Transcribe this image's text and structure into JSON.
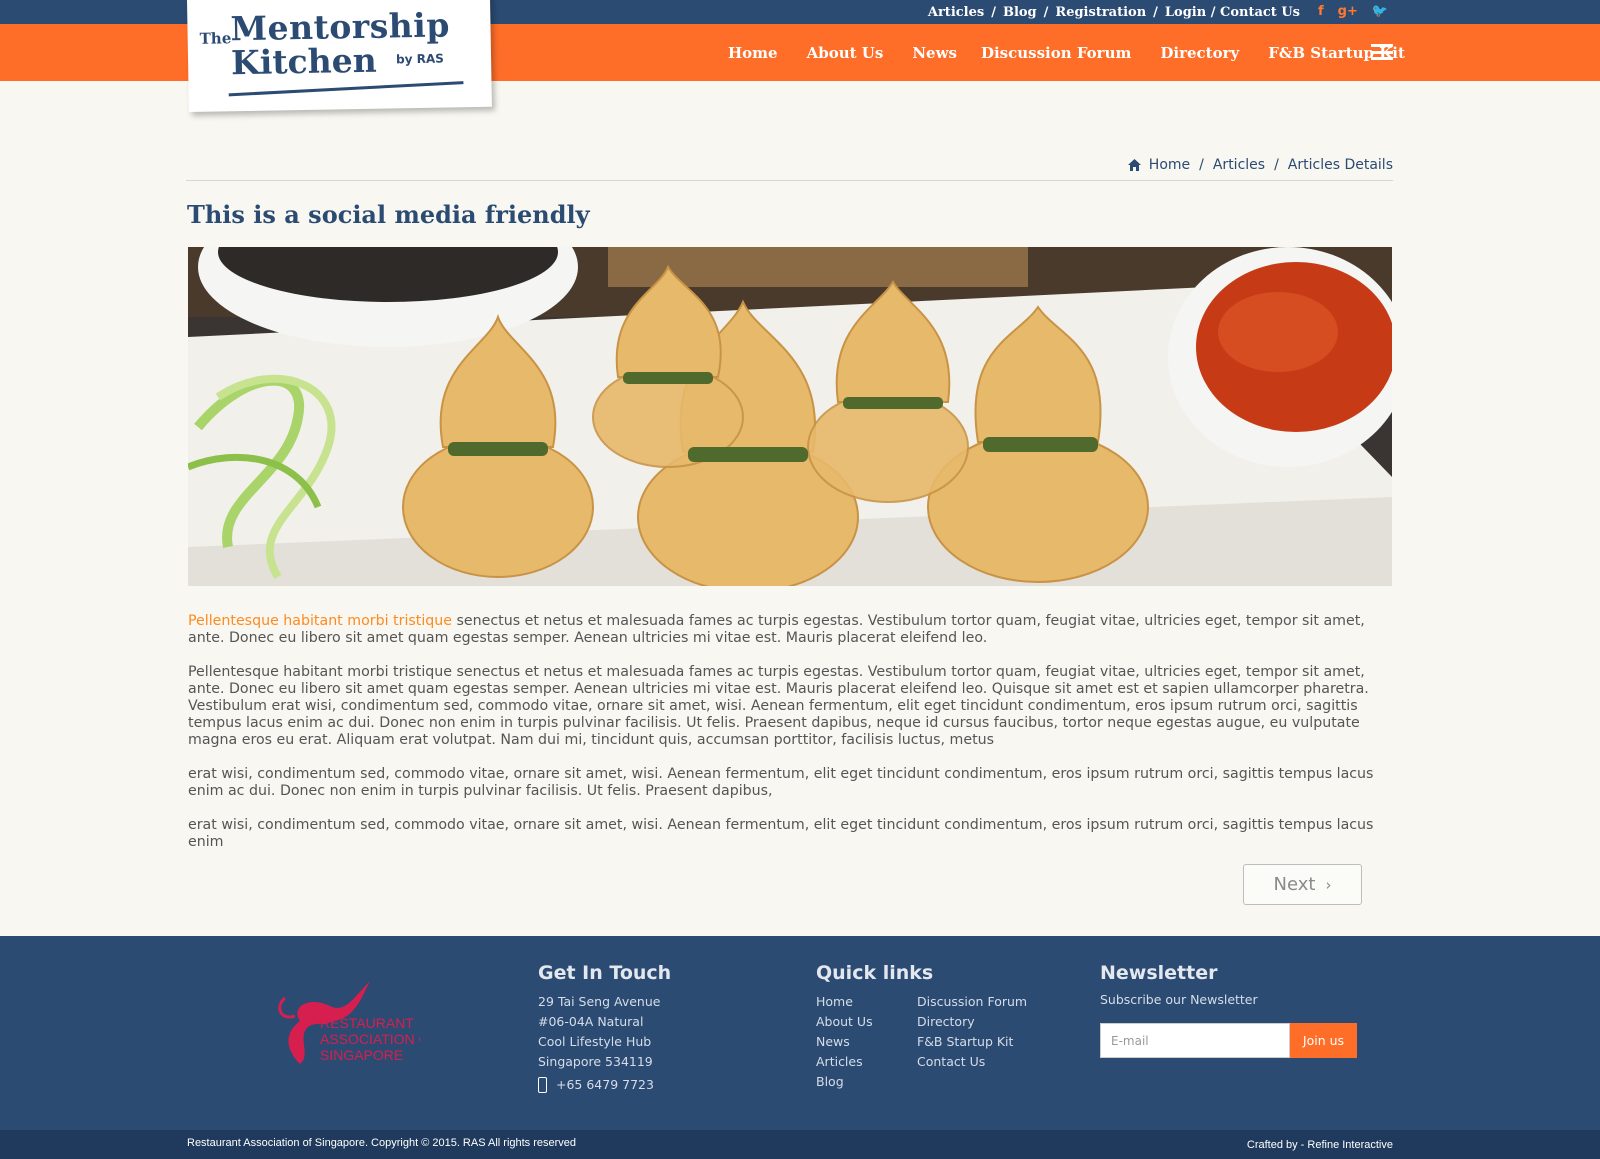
{
  "top_links": {
    "articles": "Articles",
    "blog": "Blog",
    "registration": "Registration",
    "login_contact": "Login / Contact Us",
    "separator": "/"
  },
  "social": {
    "facebook": "f",
    "google_plus": "g+",
    "twitter": "🐦"
  },
  "nav": {
    "home": "Home",
    "about": "About Us",
    "news": "News",
    "forum": "Discussion Forum",
    "directory": "Directory",
    "startup_kit": "F&B Startup Kit"
  },
  "logo": {
    "the": "The",
    "line1": "Mentorship",
    "line2": "Kitchen",
    "by": "by RAS"
  },
  "breadcrumb": {
    "home": "Home",
    "articles": "Articles",
    "current": "Articles Details",
    "separator": "/"
  },
  "article": {
    "title": "This is a social media friendly",
    "p1_highlight": "Pellentesque habitant morbi tristique",
    "p1_rest": " senectus et netus et malesuada fames ac turpis egestas. Vestibulum tortor quam, feugiat vitae, ultricies eget, tempor sit amet, ante. Donec eu libero sit amet quam egestas semper. Aenean ultricies mi vitae est. Mauris placerat eleifend leo.",
    "p2": "Pellentesque habitant morbi tristique senectus et netus et malesuada fames ac turpis egestas. Vestibulum tortor quam, feugiat vitae, ultricies eget, tempor sit amet, ante. Donec eu libero sit amet quam egestas semper. Aenean ultricies mi vitae est. Mauris placerat eleifend leo. Quisque sit amet est et sapien ullamcorper pharetra. Vestibulum erat wisi, condimentum sed, commodo vitae, ornare sit amet, wisi. Aenean fermentum, elit eget tincidunt condimentum, eros ipsum rutrum orci, sagittis tempus lacus enim ac dui. Donec non enim in turpis pulvinar facilisis. Ut felis. Praesent dapibus, neque id cursus faucibus, tortor neque egestas augue, eu vulputate magna eros eu erat. Aliquam erat volutpat. Nam dui mi, tincidunt quis, accumsan porttitor, facilisis luctus, metus",
    "p3": "erat wisi, condimentum sed, commodo vitae, ornare sit amet, wisi. Aenean fermentum, elit eget tincidunt condimentum, eros ipsum rutrum orci, sagittis tempus lacus enim ac dui. Donec non enim in turpis pulvinar facilisis. Ut felis. Praesent dapibus,",
    "p4": "erat wisi, condimentum sed, commodo vitae, ornare sit amet, wisi. Aenean fermentum, elit eget tincidunt condimentum, eros ipsum rutrum orci, sagittis tempus lacus enim",
    "next_label": "Next",
    "next_chevron": "›"
  },
  "footer": {
    "ras_logo": {
      "line1": "RESTAURANT",
      "line2": "ASSOCIATION OF",
      "line3": "SINGAPORE"
    },
    "contact": {
      "heading": "Get In Touch",
      "address1": "29 Tai Seng Avenue",
      "address2": "#06-04A Natural",
      "address3": "Cool Lifestyle Hub",
      "address4": "Singapore 534119",
      "phone": "+65 6479 7723"
    },
    "quick": {
      "heading": "Quick links",
      "col1": [
        "Home",
        "About Us",
        "News",
        "Articles",
        "Blog"
      ],
      "col2": [
        "Discussion Forum",
        "Directory",
        "F&B Startup Kit",
        "Contact Us"
      ]
    },
    "newsletter": {
      "heading": "Newsletter",
      "subtitle": "Subscribe our Newsletter",
      "email_placeholder": "E-mail",
      "join_label": "Join us"
    },
    "copyright": "Restaurant Association of Singapore. Copyright © 2015. RAS All rights reserved",
    "crafted": "Crafted by - Refine Interactive"
  },
  "colors": {
    "navy": "#2b4b73",
    "orange": "#ff6e28",
    "highlight": "#ff8a1e",
    "page_bg": "#f8f7f1"
  }
}
